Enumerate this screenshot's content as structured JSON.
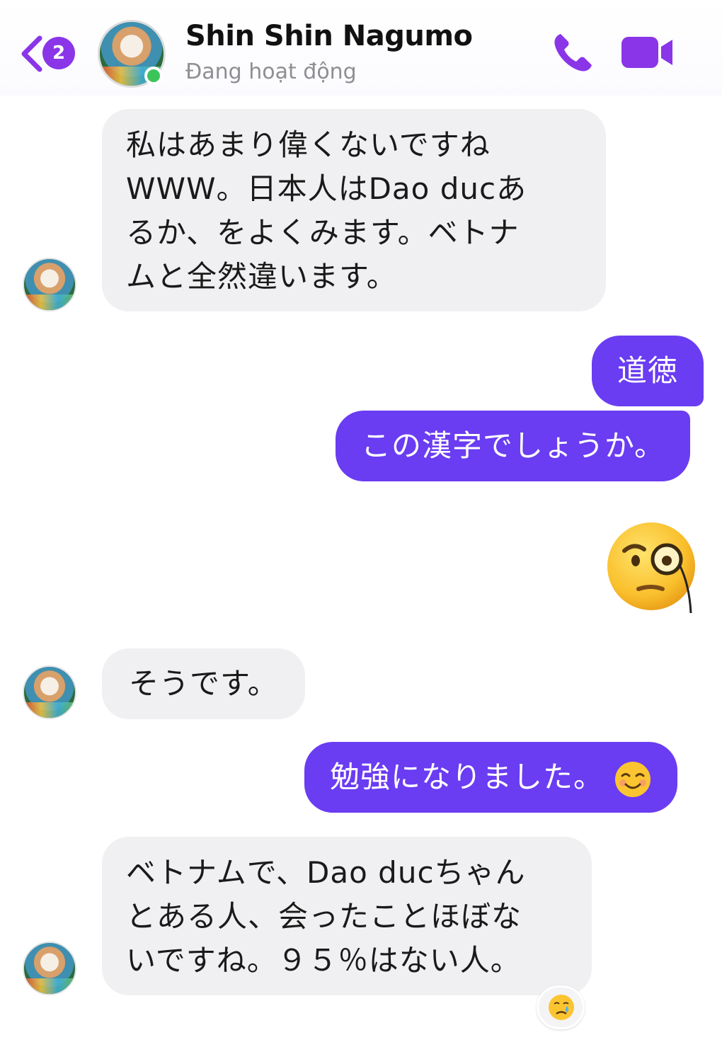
{
  "header": {
    "back_badge_count": "2",
    "contact_name": "Shin Shin Nagumo",
    "status": "Đang hoạt động",
    "icons": [
      "chevron-left-icon",
      "phone-icon",
      "video-camera-icon"
    ],
    "accent_color": "#8a35e8"
  },
  "messages": [
    {
      "side": "received",
      "lines": [
        "私はあまり偉くないですね",
        "WWW。日本人はDao ducあ",
        "るか、をよくみます。ベトナ",
        "ムと全然違います。"
      ]
    },
    {
      "side": "sent",
      "text": "道徳"
    },
    {
      "side": "sent",
      "text": "この漢字でしょうか。"
    },
    {
      "side": "sent",
      "emoji": "face-with-monocle"
    },
    {
      "side": "received",
      "text": "そうです。"
    },
    {
      "side": "sent",
      "text": "勉強になりました。",
      "emoji": "smiling-face"
    },
    {
      "side": "received",
      "lines": [
        "ベトナムで、Dao ducちゃん",
        "とある人、会ったことほぼな",
        "いですね。９５％はない人。"
      ],
      "reaction": "crying-face"
    }
  ],
  "colors": {
    "sent_bubble": "#6a3cf2",
    "received_bubble": "#f0f0f2",
    "online": "#3cc45b"
  }
}
